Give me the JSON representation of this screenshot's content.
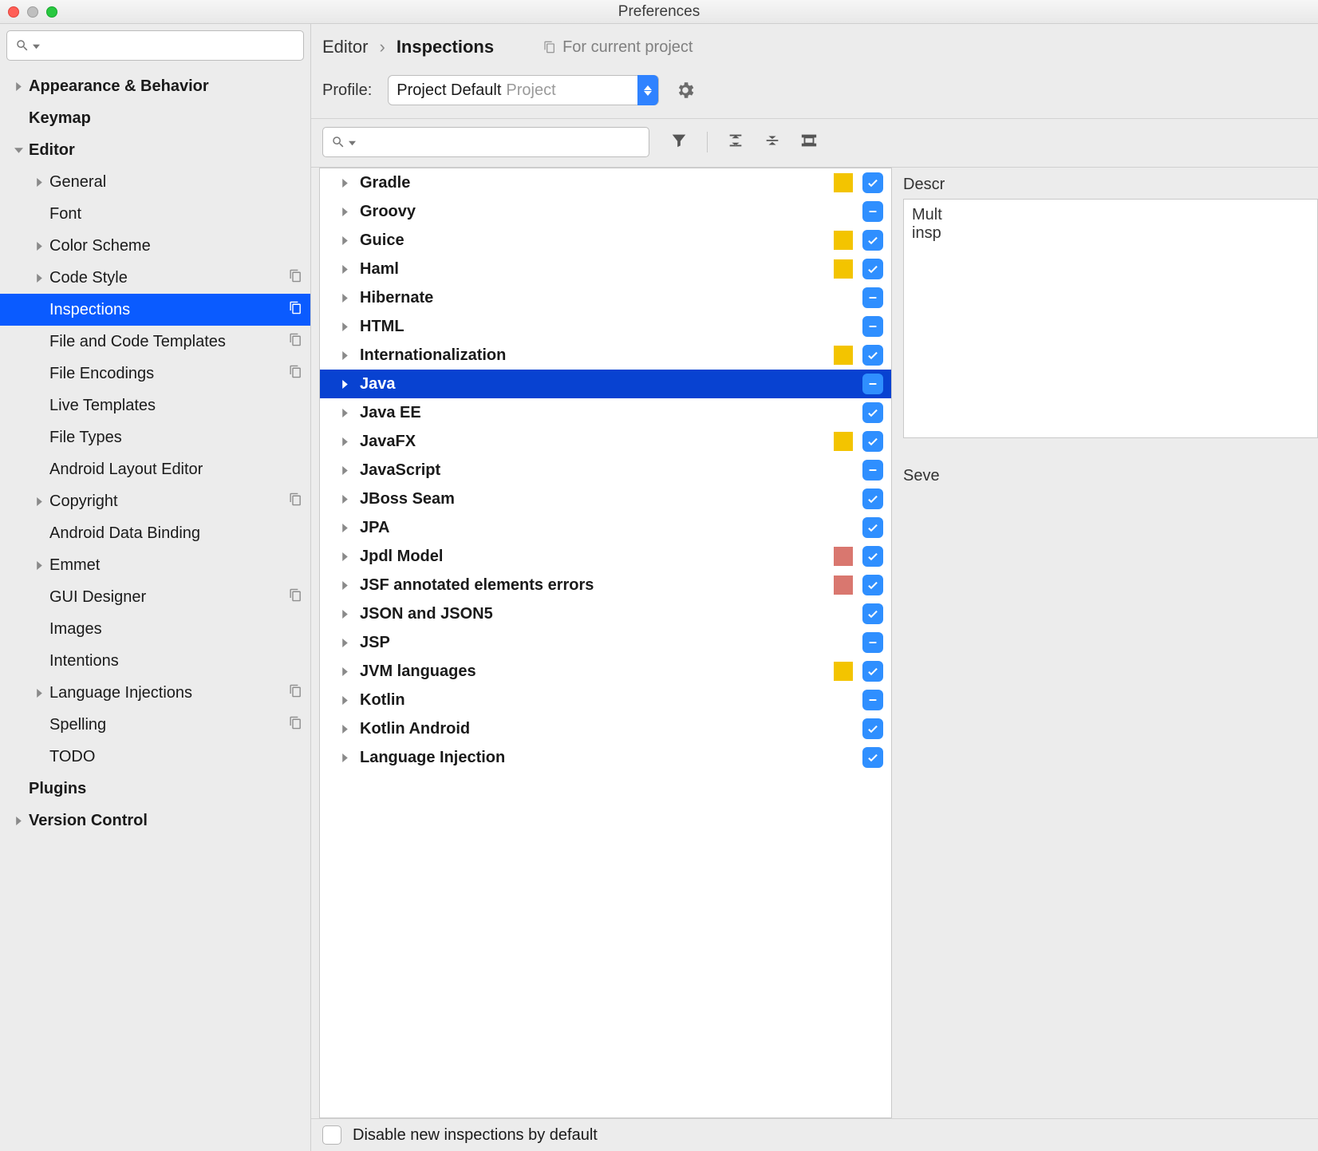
{
  "window": {
    "title": "Preferences"
  },
  "search": {
    "placeholder": ""
  },
  "sidebar": {
    "items": [
      {
        "label": "Appearance & Behavior",
        "indent": 0,
        "bold": true,
        "expandIcon": "right",
        "copy": false
      },
      {
        "label": "Keymap",
        "indent": 0,
        "bold": true,
        "expandIcon": "",
        "copy": false
      },
      {
        "label": "Editor",
        "indent": 0,
        "bold": true,
        "expandIcon": "down",
        "copy": false
      },
      {
        "label": "General",
        "indent": 1,
        "bold": false,
        "expandIcon": "right",
        "copy": false
      },
      {
        "label": "Font",
        "indent": 1,
        "bold": false,
        "expandIcon": "",
        "copy": false
      },
      {
        "label": "Color Scheme",
        "indent": 1,
        "bold": false,
        "expandIcon": "right",
        "copy": false
      },
      {
        "label": "Code Style",
        "indent": 1,
        "bold": false,
        "expandIcon": "right",
        "copy": true
      },
      {
        "label": "Inspections",
        "indent": 1,
        "bold": false,
        "expandIcon": "",
        "copy": true,
        "selected": true
      },
      {
        "label": "File and Code Templates",
        "indent": 1,
        "bold": false,
        "expandIcon": "",
        "copy": true
      },
      {
        "label": "File Encodings",
        "indent": 1,
        "bold": false,
        "expandIcon": "",
        "copy": true
      },
      {
        "label": "Live Templates",
        "indent": 1,
        "bold": false,
        "expandIcon": "",
        "copy": false
      },
      {
        "label": "File Types",
        "indent": 1,
        "bold": false,
        "expandIcon": "",
        "copy": false
      },
      {
        "label": "Android Layout Editor",
        "indent": 1,
        "bold": false,
        "expandIcon": "",
        "copy": false
      },
      {
        "label": "Copyright",
        "indent": 1,
        "bold": false,
        "expandIcon": "right",
        "copy": true
      },
      {
        "label": "Android Data Binding",
        "indent": 1,
        "bold": false,
        "expandIcon": "",
        "copy": false
      },
      {
        "label": "Emmet",
        "indent": 1,
        "bold": false,
        "expandIcon": "right",
        "copy": false
      },
      {
        "label": "GUI Designer",
        "indent": 1,
        "bold": false,
        "expandIcon": "",
        "copy": true
      },
      {
        "label": "Images",
        "indent": 1,
        "bold": false,
        "expandIcon": "",
        "copy": false
      },
      {
        "label": "Intentions",
        "indent": 1,
        "bold": false,
        "expandIcon": "",
        "copy": false
      },
      {
        "label": "Language Injections",
        "indent": 1,
        "bold": false,
        "expandIcon": "right",
        "copy": true
      },
      {
        "label": "Spelling",
        "indent": 1,
        "bold": false,
        "expandIcon": "",
        "copy": true
      },
      {
        "label": "TODO",
        "indent": 1,
        "bold": false,
        "expandIcon": "",
        "copy": false
      },
      {
        "label": "Plugins",
        "indent": 0,
        "bold": true,
        "expandIcon": "",
        "copy": false
      },
      {
        "label": "Version Control",
        "indent": 0,
        "bold": true,
        "expandIcon": "right",
        "copy": false
      }
    ]
  },
  "breadcrumb": {
    "root": "Editor",
    "leaf": "Inspections"
  },
  "scope": {
    "label": "For current project"
  },
  "profile": {
    "label": "Profile:",
    "selected": "Project Default",
    "hint": "Project"
  },
  "inspections": {
    "search_placeholder": "",
    "items": [
      {
        "label": "Gradle",
        "swatch": "yellow",
        "check": "check"
      },
      {
        "label": "Groovy",
        "swatch": "",
        "check": "indet"
      },
      {
        "label": "Guice",
        "swatch": "yellow",
        "check": "check"
      },
      {
        "label": "Haml",
        "swatch": "yellow",
        "check": "check"
      },
      {
        "label": "Hibernate",
        "swatch": "",
        "check": "indet"
      },
      {
        "label": "HTML",
        "swatch": "",
        "check": "indet"
      },
      {
        "label": "Internationalization",
        "swatch": "yellow",
        "check": "check"
      },
      {
        "label": "Java",
        "swatch": "",
        "check": "indet",
        "selected": true
      },
      {
        "label": "Java EE",
        "swatch": "",
        "check": "check"
      },
      {
        "label": "JavaFX",
        "swatch": "yellow",
        "check": "check"
      },
      {
        "label": "JavaScript",
        "swatch": "",
        "check": "indet"
      },
      {
        "label": "JBoss Seam",
        "swatch": "",
        "check": "check"
      },
      {
        "label": "JPA",
        "swatch": "",
        "check": "check"
      },
      {
        "label": "Jpdl Model",
        "swatch": "red",
        "check": "check"
      },
      {
        "label": "JSF annotated elements errors",
        "swatch": "red",
        "check": "check"
      },
      {
        "label": "JSON and JSON5",
        "swatch": "",
        "check": "check"
      },
      {
        "label": "JSP",
        "swatch": "",
        "check": "indet"
      },
      {
        "label": "JVM languages",
        "swatch": "yellow",
        "check": "check"
      },
      {
        "label": "Kotlin",
        "swatch": "",
        "check": "indet"
      },
      {
        "label": "Kotlin Android",
        "swatch": "",
        "check": "check"
      },
      {
        "label": "Language Injection",
        "swatch": "",
        "check": "check"
      }
    ]
  },
  "info": {
    "descLabel": "Descr",
    "box1line1": "Mult",
    "box1line2": "insp",
    "severityLabel": "Seve"
  },
  "footer": {
    "disable_label": "Disable new inspections by default"
  }
}
